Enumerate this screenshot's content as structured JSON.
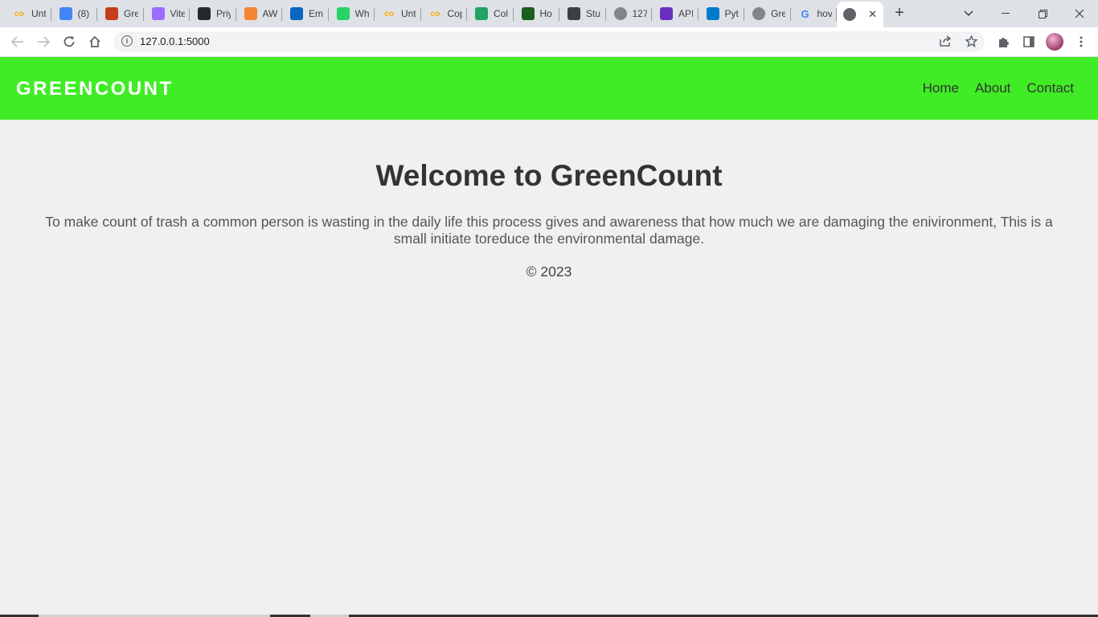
{
  "browser": {
    "tabs": [
      {
        "title": "Unt",
        "icon": "colab-icon",
        "color": "#f9ab00"
      },
      {
        "title": "(8)",
        "icon": "gmail-badge-icon",
        "color": "#4285f4"
      },
      {
        "title": "Gre",
        "icon": "powerpoint-icon",
        "color": "#c43e1c"
      },
      {
        "title": "Vite",
        "icon": "vite-icon",
        "color": "#9c6bff"
      },
      {
        "title": "Priy",
        "icon": "github-icon",
        "color": "#24292f"
      },
      {
        "title": "AW",
        "icon": "aws-box-icon",
        "color": "#f58536"
      },
      {
        "title": "Em",
        "icon": "outlook-icon",
        "color": "#0a64c2"
      },
      {
        "title": "Wh",
        "icon": "whatsapp-icon",
        "color": "#25d366"
      },
      {
        "title": "Unt",
        "icon": "colab-icon",
        "color": "#f9ab00"
      },
      {
        "title": "Cop",
        "icon": "colab-icon",
        "color": "#f9ab00"
      },
      {
        "title": "Col",
        "icon": "google-drive-icon",
        "color": "#1fa463"
      },
      {
        "title": "Ho",
        "icon": "word-w-icon",
        "color": "#1b5e20"
      },
      {
        "title": "Stu",
        "icon": "stu-icon",
        "color": "#3c4043"
      },
      {
        "title": "127",
        "icon": "globe-icon",
        "color": "#5f6368"
      },
      {
        "title": "API",
        "icon": "api-icon",
        "color": "#6b2fbf"
      },
      {
        "title": "Pyt",
        "icon": "vscode-icon",
        "color": "#007acc"
      },
      {
        "title": "Gre",
        "icon": "globe-icon",
        "color": "#5f6368"
      },
      {
        "title": "hov",
        "icon": "google-icon",
        "color": "#4285f4"
      }
    ],
    "active_tab": {
      "icon": "globe-icon",
      "close": "✕"
    },
    "new_tab": "+",
    "url": "127.0.0.1:5000"
  },
  "site": {
    "brand": "GREENCOUNT",
    "nav": {
      "home": "Home",
      "about": "About",
      "contact": "Contact"
    },
    "heading": "Welcome to GreenCount",
    "description": "To make count of trash a common person is wasting in the daily life this process gives and awareness that how much we are damaging the enivironment, This is a small initiate toreduce the environmental damage.",
    "footer": "© 2023"
  },
  "colors": {
    "header_green": "#40ec25",
    "page_bg": "#f0f0f0"
  }
}
